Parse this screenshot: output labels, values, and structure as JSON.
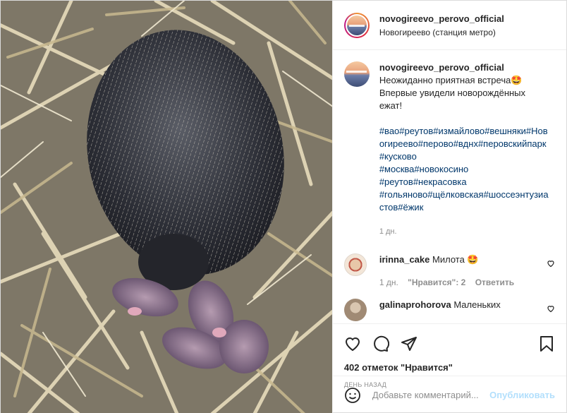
{
  "header": {
    "username": "novogireevo_perovo_official",
    "location": "Новогиреево (станция метро)"
  },
  "post": {
    "username": "novogireevo_perovo_official",
    "text": "Неожиданно приятная встреча🤩\nВпервые увидели новорождённых ежат!",
    "hashtags": "#вао#реутов#измайлово#вешняки#Новогиреево#перово#вднх#перовскийпарк#кусково\n#москва#новокосино\n#реутов#некрасовка\n#гольяново#щёлковская#шоссеэнтузиастов#ёжик",
    "time": "1 дн."
  },
  "comments": [
    {
      "username": "irinna_cake",
      "text": "Милота 🤩",
      "time": "1 дн.",
      "likes": "\"Нравится\": 2",
      "reply": "Ответить"
    },
    {
      "username": "galinaprohorova",
      "text": "Маленьких"
    }
  ],
  "actions": {
    "likes": "402 отметок \"Нравится\"",
    "date": "ДЕНЬ НАЗАД"
  },
  "add_comment": {
    "placeholder": "Добавьте комментарий...",
    "post_label": "Опубликовать"
  },
  "icons": {
    "like": "heart-icon",
    "comment": "comment-icon",
    "share": "share-icon",
    "save": "bookmark-icon",
    "emoji": "emoji-icon",
    "comment_like": "small-heart-icon"
  },
  "colors": {
    "hashtag": "#00376b",
    "muted": "#8e8e8e",
    "post_button_disabled": "#b2dffc"
  }
}
